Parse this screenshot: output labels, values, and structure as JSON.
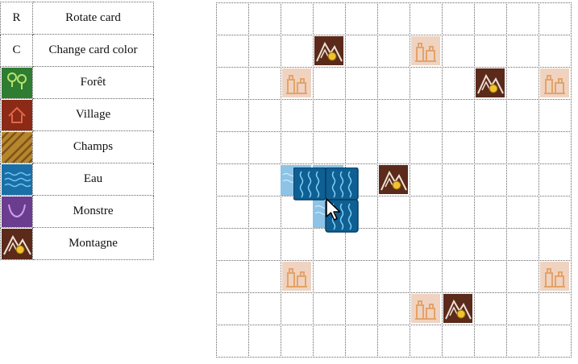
{
  "legend": [
    {
      "key": "R",
      "label": "Rotate card"
    },
    {
      "key": "C",
      "label": "Change card color"
    },
    {
      "icon": "forest-icon",
      "label": "Forêt",
      "color": "#2e7d32"
    },
    {
      "icon": "village-icon",
      "label": "Village",
      "color": "#8b2a16"
    },
    {
      "icon": "fields-icon",
      "label": "Champs",
      "color": "#b7852e"
    },
    {
      "icon": "water-icon",
      "label": "Eau",
      "color": "#1a6fa6"
    },
    {
      "icon": "monster-icon",
      "label": "Monstre",
      "color": "#6a3d8f"
    },
    {
      "icon": "mountain-icon",
      "label": "Montagne",
      "color": "#5b2a1a"
    }
  ],
  "board": {
    "rows": 11,
    "cols": 11,
    "tiles": [
      {
        "row": 1,
        "col": 3,
        "type": "mountain"
      },
      {
        "row": 1,
        "col": 6,
        "type": "ruins"
      },
      {
        "row": 2,
        "col": 2,
        "type": "ruins"
      },
      {
        "row": 2,
        "col": 8,
        "type": "mountain"
      },
      {
        "row": 2,
        "col": 10,
        "type": "ruins"
      },
      {
        "row": 5,
        "col": 5,
        "type": "mountain"
      },
      {
        "row": 8,
        "col": 2,
        "type": "ruins"
      },
      {
        "row": 8,
        "col": 10,
        "type": "ruins"
      },
      {
        "row": 9,
        "col": 6,
        "type": "ruins"
      },
      {
        "row": 9,
        "col": 7,
        "type": "mountain"
      }
    ]
  },
  "held_card": {
    "terrain": "water",
    "color": "#1a6fa6"
  }
}
